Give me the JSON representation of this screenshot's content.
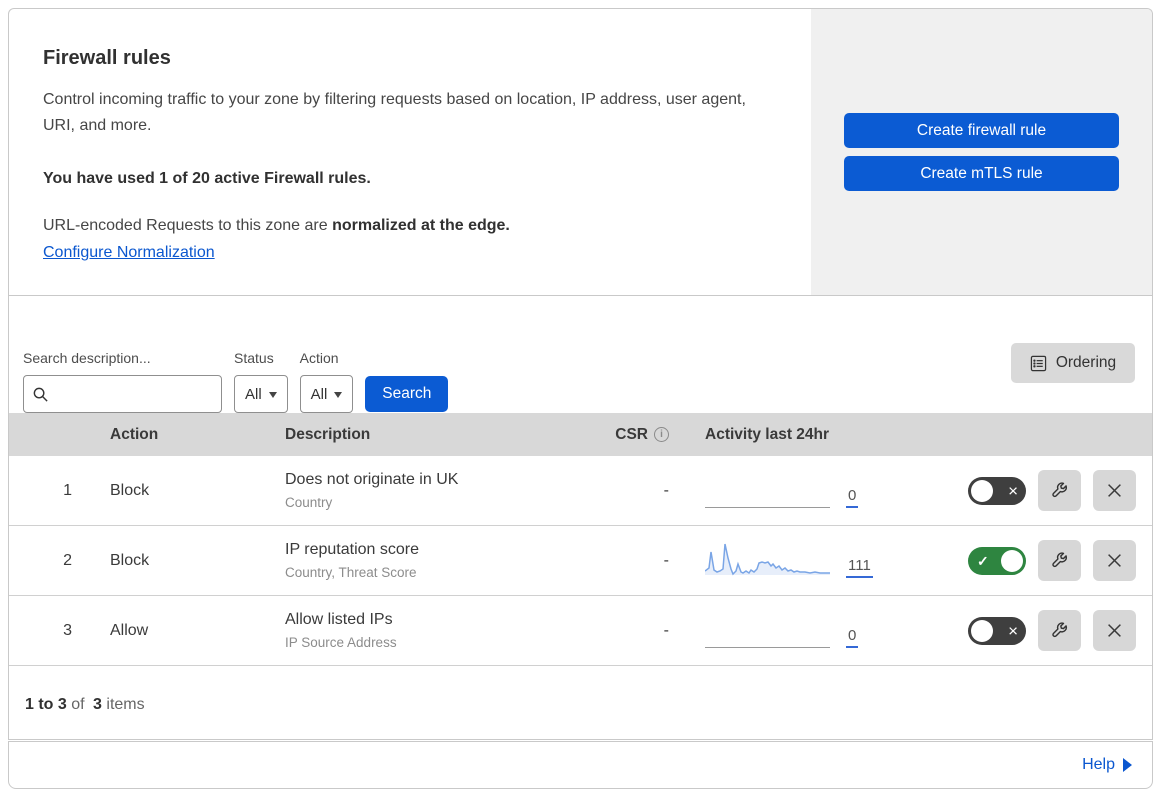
{
  "header": {
    "title": "Firewall rules",
    "description": "Control incoming traffic to your zone by filtering requests based on location, IP address, user agent, URI, and more.",
    "usage_line": "You have used 1 of 20 active Firewall rules.",
    "normalization_prefix": "URL-encoded Requests to this zone are ",
    "normalization_bold": "normalized at the edge.",
    "normalization_link": "Configure Normalization",
    "create_firewall_button": "Create firewall rule",
    "create_mtls_button": "Create mTLS rule"
  },
  "filters": {
    "search_label": "Search description...",
    "search_value": "",
    "status_label": "Status",
    "status_value": "All",
    "action_label": "Action",
    "action_value": "All",
    "search_button": "Search",
    "ordering_button": "Ordering"
  },
  "table": {
    "columns": {
      "action": "Action",
      "description": "Description",
      "csr": "CSR",
      "activity": "Activity last 24hr"
    },
    "rows": [
      {
        "index": "1",
        "action": "Block",
        "title": "Does not originate in UK",
        "subtitle": "Country",
        "csr": "-",
        "activity_count": "0",
        "enabled": false
      },
      {
        "index": "2",
        "action": "Block",
        "title": "IP reputation score",
        "subtitle": "Country, Threat Score",
        "csr": "-",
        "activity_count": "111",
        "enabled": true,
        "sparkline": [
          [
            0,
            33
          ],
          [
            4,
            30
          ],
          [
            6,
            14
          ],
          [
            9,
            32
          ],
          [
            12,
            34
          ],
          [
            15,
            33
          ],
          [
            18,
            31
          ],
          [
            20,
            6
          ],
          [
            23,
            20
          ],
          [
            26,
            31
          ],
          [
            28,
            36
          ],
          [
            31,
            33
          ],
          [
            33,
            26
          ],
          [
            36,
            34
          ],
          [
            38,
            35
          ],
          [
            41,
            33
          ],
          [
            44,
            35
          ],
          [
            46,
            32
          ],
          [
            49,
            34
          ],
          [
            52,
            31
          ],
          [
            54,
            25
          ],
          [
            57,
            24
          ],
          [
            60,
            25
          ],
          [
            63,
            24
          ],
          [
            66,
            28
          ],
          [
            68,
            26
          ],
          [
            71,
            30
          ],
          [
            74,
            28
          ],
          [
            77,
            32
          ],
          [
            80,
            30
          ],
          [
            83,
            33
          ],
          [
            86,
            32
          ],
          [
            89,
            34
          ],
          [
            92,
            33
          ],
          [
            95,
            34
          ],
          [
            100,
            34
          ],
          [
            105,
            35
          ],
          [
            110,
            34
          ],
          [
            115,
            35
          ],
          [
            120,
            35
          ],
          [
            125,
            35
          ]
        ]
      },
      {
        "index": "3",
        "action": "Allow",
        "title": "Allow listed IPs",
        "subtitle": "IP Source Address",
        "csr": "-",
        "activity_count": "0",
        "enabled": false
      }
    ],
    "footer": {
      "range_bold": "1 to 3",
      "of_text": "of",
      "total_bold": "3",
      "items_text": "items"
    }
  },
  "help": {
    "label": "Help"
  },
  "icons": {
    "csr_info": "i",
    "toggle_check": "✓",
    "toggle_cross": "×"
  },
  "colors": {
    "accent_blue": "#0b5bd3",
    "link_blue": "#0b57cf",
    "toggle_on_green": "#2e8540",
    "toggle_off_gray": "#3f3f3f",
    "sparkline_blue": "#7aa5e6",
    "table_header_gray": "#d8d8d8",
    "panel_gray": "#f0f0f0"
  }
}
